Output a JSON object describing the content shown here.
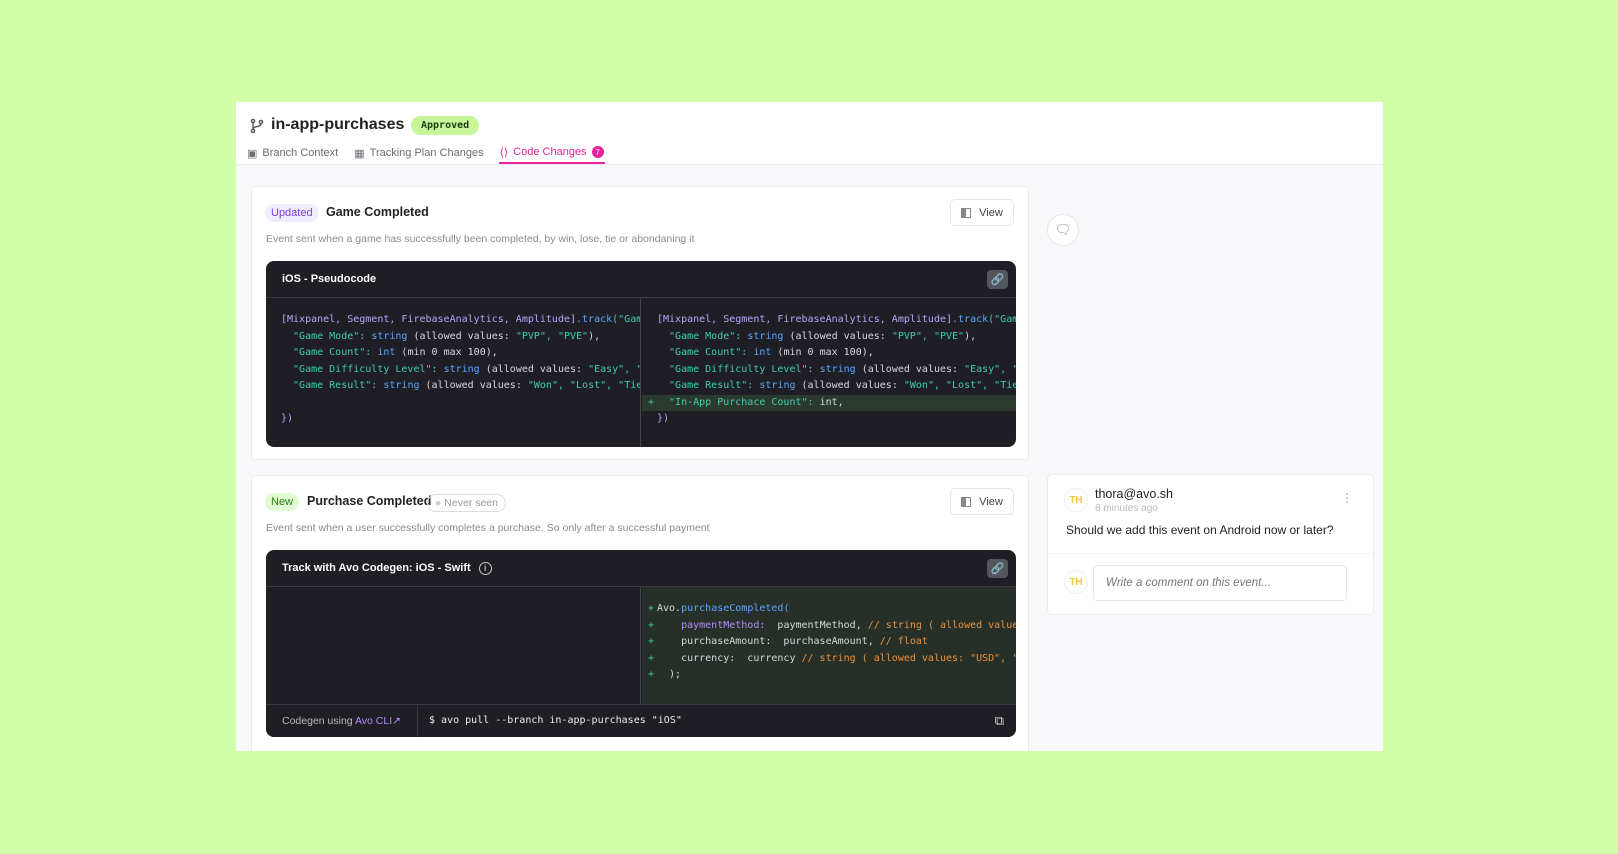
{
  "header": {
    "branch": "in-app-purchases",
    "status": "Approved",
    "tabs": [
      {
        "label": "Branch Context",
        "icon": "clipboard-icon"
      },
      {
        "label": "Tracking Plan Changes",
        "icon": "table-icon"
      },
      {
        "label": "Code Changes",
        "icon": "code-icon",
        "count": "7",
        "active": true
      }
    ]
  },
  "events": [
    {
      "status": "Updated",
      "name": "Game Completed",
      "description": "Event sent when a game has successfully been completed, by win, lose, tie or abondaning it",
      "view_label": "View",
      "code_title": "iOS - Pseudocode",
      "left": [
        [
          [
            "[Mixpanel, Segment, FirebaseAnalytics, Amplitude]",
            "br"
          ],
          [
            ".track",
            "fn"
          ],
          [
            "(\"Game Completed\",",
            "str"
          ]
        ],
        [
          [
            "  \"Game Mode\": ",
            "str"
          ],
          [
            "string ",
            "kw"
          ],
          [
            "(allowed values: ",
            "tx"
          ],
          [
            "\"PVP\", \"PVE\"",
            "str"
          ],
          [
            "),",
            "tx"
          ]
        ],
        [
          [
            "  \"Game Count\": ",
            "str"
          ],
          [
            "int ",
            "kw"
          ],
          [
            "(min 0 max 100),",
            "tx"
          ]
        ],
        [
          [
            "  \"Game Difficulty Level\": ",
            "str"
          ],
          [
            "string ",
            "kw"
          ],
          [
            "(allowed values: ",
            "tx"
          ],
          [
            "\"Easy\", \"Medium\", \"Hard\"",
            "str"
          ],
          [
            "),",
            "tx"
          ]
        ],
        [
          [
            "  \"Game Result\": ",
            "str"
          ],
          [
            "string ",
            "kw"
          ],
          [
            "(allowed values: ",
            "tx"
          ],
          [
            "\"Won\", \"Lost\", \"Tie\", \"Forfeit\"",
            "str"
          ],
          [
            "),",
            "tx"
          ]
        ],
        [],
        [
          [
            "})",
            "br"
          ]
        ]
      ],
      "right": [
        [
          [
            "[Mixpanel, Segment, FirebaseAnalytics, Amplitude]",
            "br"
          ],
          [
            ".track",
            "fn"
          ],
          [
            "(\"Game Completed\",",
            "str"
          ]
        ],
        [
          [
            "  \"Game Mode\": ",
            "str"
          ],
          [
            "string ",
            "kw"
          ],
          [
            "(allowed values: ",
            "tx"
          ],
          [
            "\"PVP\", \"PVE\"",
            "str"
          ],
          [
            "),",
            "tx"
          ]
        ],
        [
          [
            "  \"Game Count\": ",
            "str"
          ],
          [
            "int ",
            "kw"
          ],
          [
            "(min 0 max 100),",
            "tx"
          ]
        ],
        [
          [
            "  \"Game Difficulty Level\": ",
            "str"
          ],
          [
            "string ",
            "kw"
          ],
          [
            "(allowed values: ",
            "tx"
          ],
          [
            "\"Easy\", \"Medium\", \"Hard\"",
            "str"
          ],
          [
            "),",
            "tx"
          ]
        ],
        [
          [
            "  \"Game Result\": ",
            "str"
          ],
          [
            "string ",
            "kw"
          ],
          [
            "(allowed values: ",
            "tx"
          ],
          [
            "\"Won\", \"Lost\", \"Tie\", \"Forfeit\"",
            "str"
          ],
          [
            "),",
            "tx"
          ]
        ],
        [
          [
            "+",
            "add"
          ],
          [
            "  \"In-App Purchace Count\": ",
            "str"
          ],
          [
            "int,",
            "tx"
          ]
        ],
        [
          [
            "})",
            "br"
          ]
        ]
      ]
    },
    {
      "status": "New",
      "name": "Purchase Completed",
      "seen": "Never seen",
      "description": "Event sent when a user successfully completes a purchase. So only after a successful payment",
      "view_label": "View",
      "code_title": "Track with Avo Codegen: iOS - Swift",
      "right": [
        [
          [
            "+",
            "add"
          ],
          [
            "Avo.",
            "tx"
          ],
          [
            "purchaseCompleted(",
            "fn"
          ]
        ],
        [
          [
            "+",
            "add"
          ],
          [
            "    paymentMethod:  ",
            "pm"
          ],
          [
            "paymentMethod, ",
            "tx"
          ],
          [
            "// string ( allowed values: \"Apple Pay\", \"Card\")",
            "cm"
          ]
        ],
        [
          [
            "+",
            "add"
          ],
          [
            "    purchaseAmount:  purchaseAmount, ",
            "tx"
          ],
          [
            "// float",
            "cm"
          ]
        ],
        [
          [
            "+",
            "add"
          ],
          [
            "    currency:  currency ",
            "tx"
          ],
          [
            "// string ( allowed values: \"USD\", \"EUR\")",
            "cm"
          ]
        ],
        [
          [
            "+",
            "add"
          ],
          [
            "  );",
            "tx"
          ]
        ]
      ],
      "footer": {
        "prefix": "Codegen using ",
        "link": "Avo CLI↗",
        "command": "$ avo pull --branch in-app-purchases \"iOS\""
      }
    }
  ],
  "comments": {
    "author": "thora@avo.sh",
    "initials": "TH",
    "time": "8 minutes ago",
    "text": "Should we add this event on Android now or later?",
    "placeholder": "Write a comment on this event..."
  }
}
